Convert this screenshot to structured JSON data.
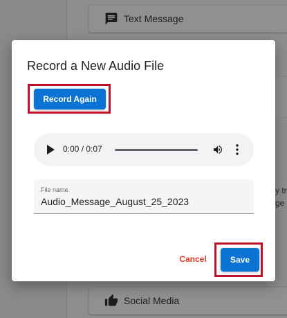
{
  "background": {
    "top_card_label": "Text Message",
    "bottom_card_label": "Social Media",
    "side_text_1": "y tr",
    "side_text_2": "ge",
    "top_card_icon": "message-icon",
    "bottom_card_icon": "thumbs-up-icon"
  },
  "dialog": {
    "title": "Record a New Audio File",
    "record_again_label": "Record Again",
    "audio": {
      "time": "0:00 / 0:07",
      "progress_fraction": 0,
      "play_icon": "play-icon",
      "volume_icon": "volume-icon",
      "more_icon": "more-vert-icon"
    },
    "file_name": {
      "label": "File name",
      "value": "Audio_Message_August_25_2023"
    },
    "cancel_label": "Cancel",
    "save_label": "Save"
  },
  "colors": {
    "primary": "#0a73d3",
    "cancel": "#d93b22",
    "highlight": "#c0102a"
  }
}
